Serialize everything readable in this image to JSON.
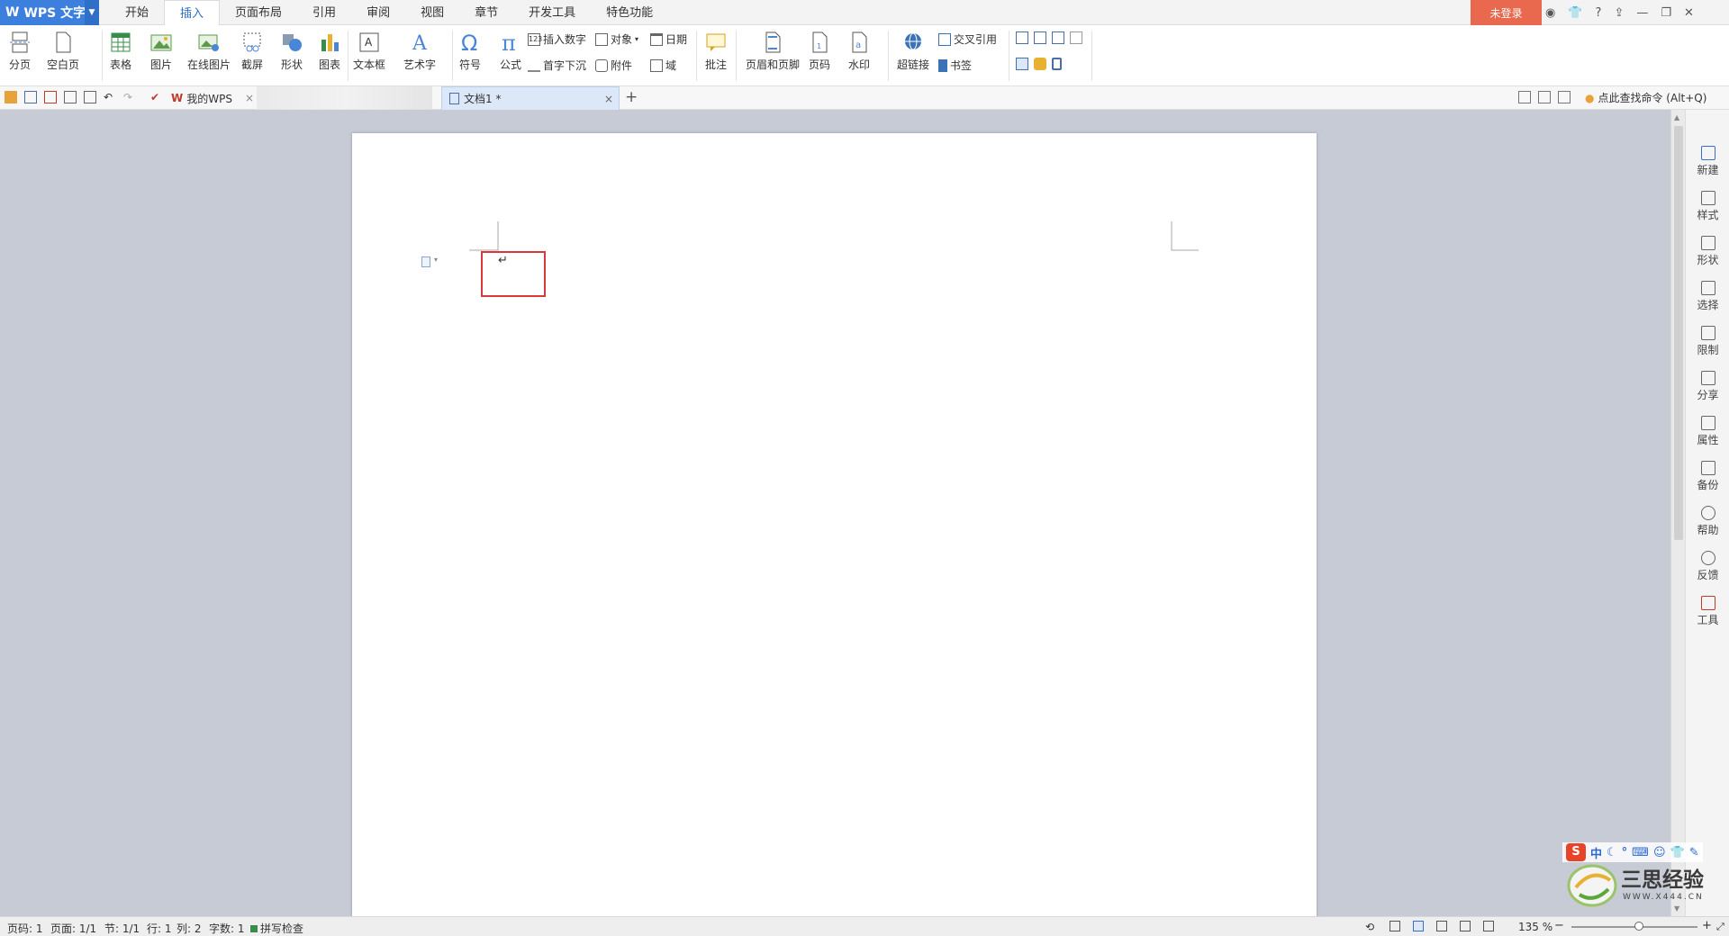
{
  "app": {
    "name": "WPS 文字"
  },
  "menu": {
    "tabs": [
      "开始",
      "插入",
      "页面布局",
      "引用",
      "审阅",
      "视图",
      "章节",
      "开发工具",
      "特色功能"
    ],
    "active_tab": "插入",
    "login": "未登录",
    "help": "?"
  },
  "ribbon": {
    "page_break": "分页",
    "blank_page": "空白页",
    "table": "表格",
    "picture": "图片",
    "online_picture": "在线图片",
    "screenshot": "截屏",
    "shape": "形状",
    "chart": "图表",
    "textbox": "文本框",
    "wordart": "艺术字",
    "symbol": "符号",
    "formula": "公式",
    "insert_number": "插入数字",
    "object": "对象",
    "date": "日期",
    "drop_cap": "首字下沉",
    "attachment": "附件",
    "field": "域",
    "comment": "批注",
    "header_footer": "页眉和页脚",
    "page_number": "页码",
    "watermark": "水印",
    "hyperlink": "超链接",
    "cross_ref": "交叉引用",
    "bookmark": "书签"
  },
  "docbar": {
    "my_wps": "我的WPS",
    "active_doc": "文档1 *",
    "search_cmd": "点此查找命令 (Alt+Q)"
  },
  "side_panel": [
    "新建",
    "样式",
    "形状",
    "选择",
    "限制",
    "分享",
    "属性",
    "备份",
    "帮助",
    "反馈",
    "工具"
  ],
  "status": {
    "page_code": "页码: 1",
    "pages": "页面: 1/1",
    "section": "节: 1/1",
    "row": "行: 1",
    "col": "列: 2",
    "words": "字数: 1",
    "spell": "拼写检查",
    "zoom": "135 %"
  },
  "colors": {
    "accent": "#3d7fdc",
    "login_bg": "#e8694e",
    "highlight_box": "#d9393a"
  },
  "watermark_brand": {
    "cn": "三思经验",
    "url": "WWW.X444.CN"
  },
  "ime": {
    "label": "中"
  }
}
